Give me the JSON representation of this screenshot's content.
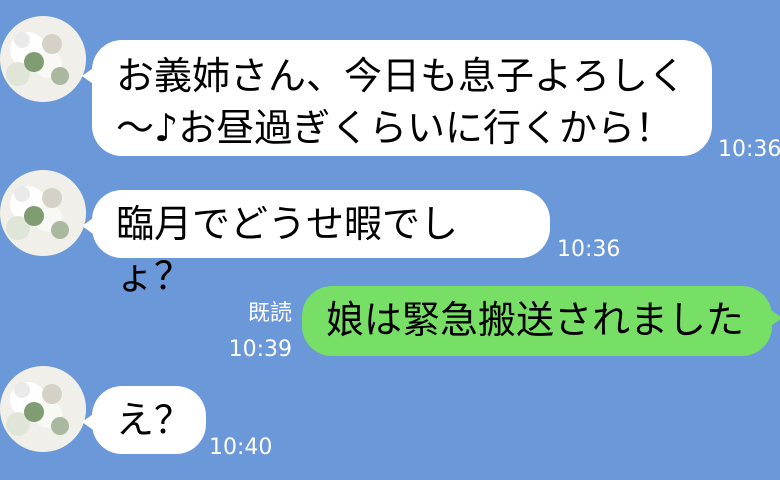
{
  "messages": [
    {
      "direction": "incoming",
      "text": "お義姉さん、今日も息子よろしく\n〜♪お昼過ぎくらいに行くから！",
      "time": "10:36"
    },
    {
      "direction": "incoming",
      "text": "臨月でどうせ暇でしょ？",
      "time": "10:36"
    },
    {
      "direction": "outgoing",
      "text": "娘は緊急搬送されました",
      "read_label": "既読",
      "time": "10:39"
    },
    {
      "direction": "incoming",
      "text": "え？",
      "time": "10:40"
    }
  ],
  "colors": {
    "background": "#6b98d9",
    "incoming_bubble": "#ffffff",
    "outgoing_bubble": "#78df66",
    "meta_text": "#ffffff"
  },
  "avatar": {
    "icon": "flower-bouquet-icon"
  }
}
